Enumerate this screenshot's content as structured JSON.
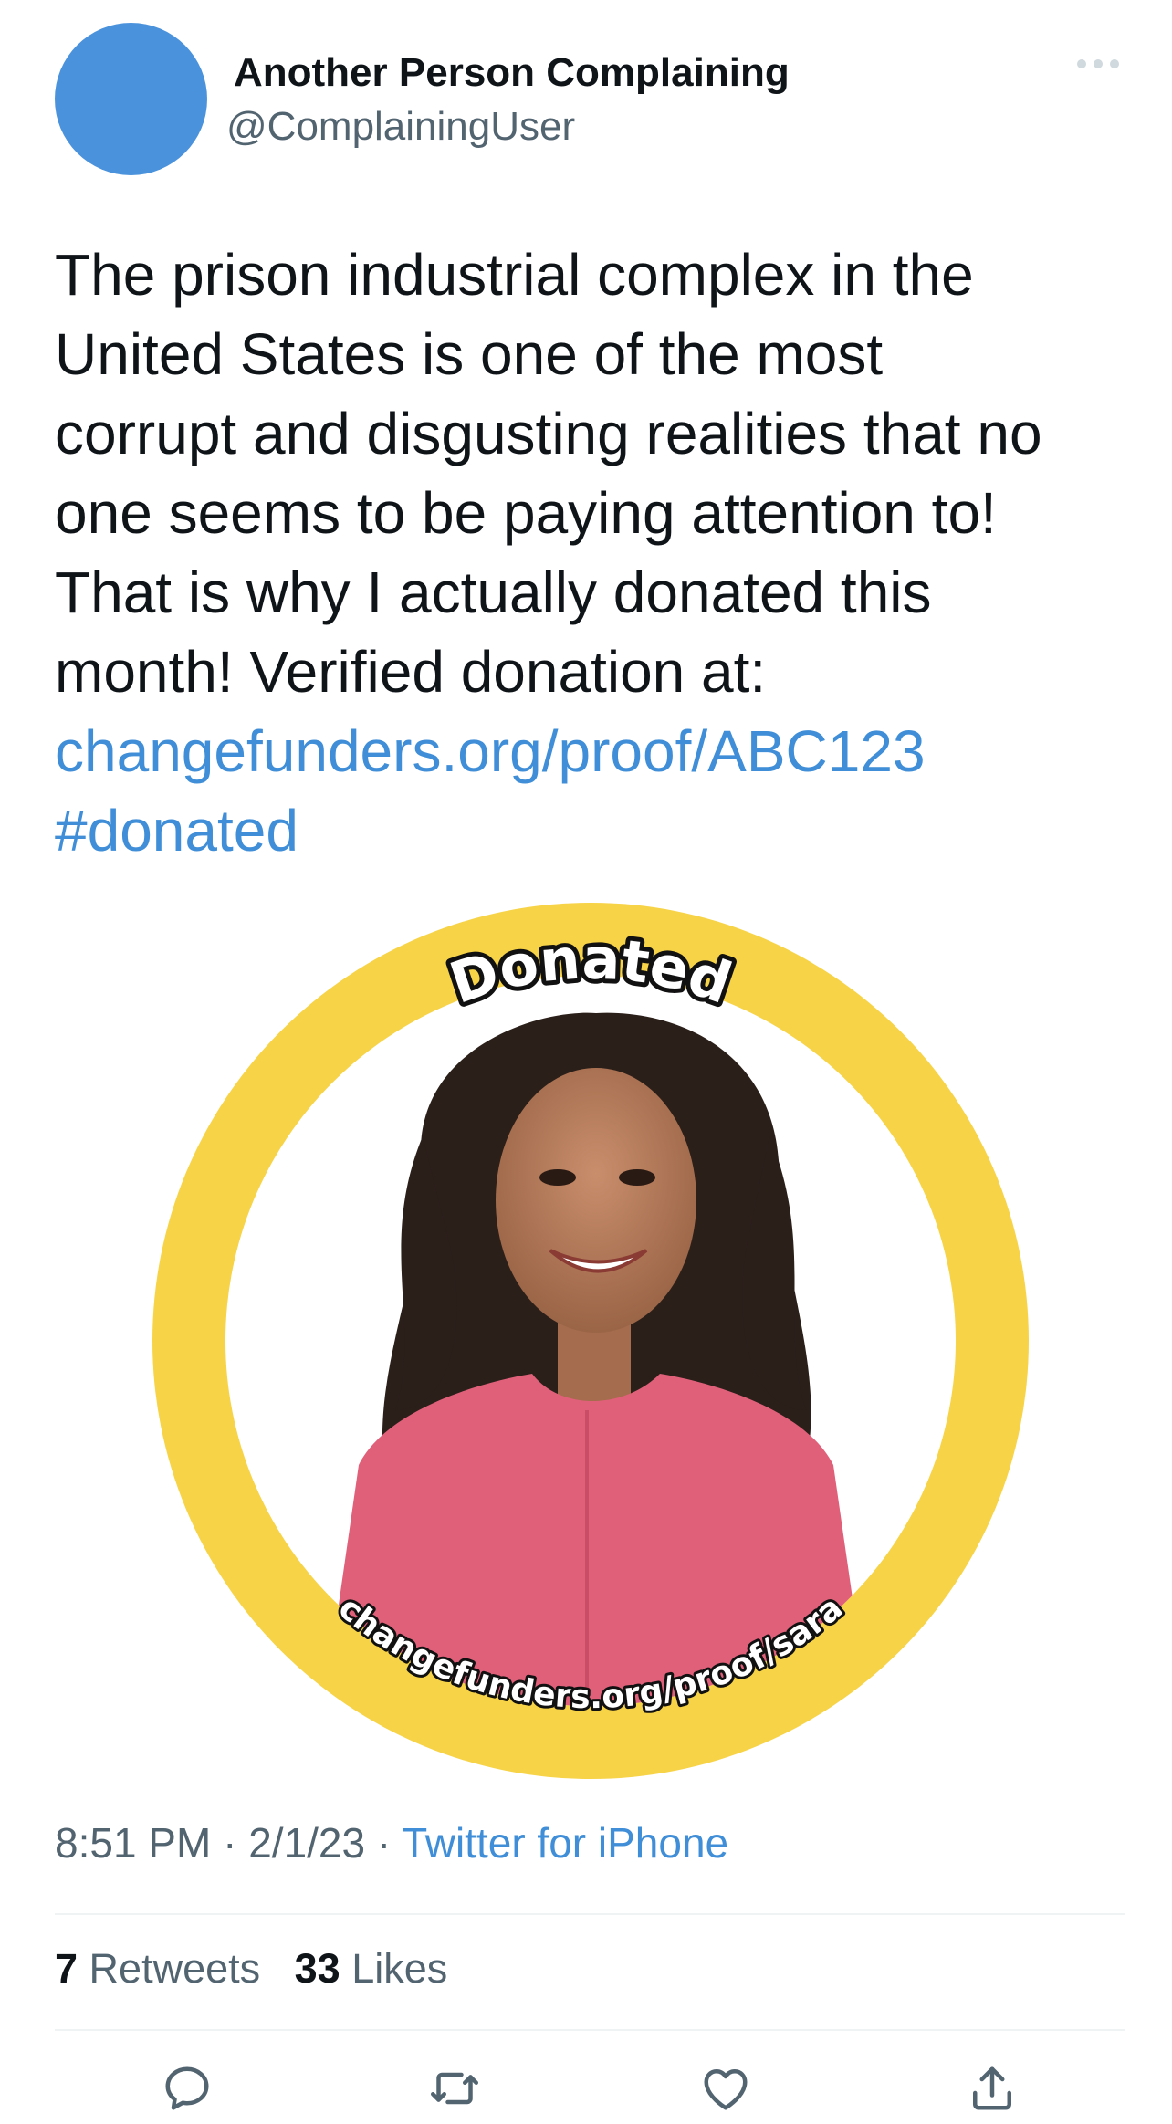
{
  "tweet": {
    "author": {
      "display_name": "Another Person Complaining",
      "handle": "@ComplainingUser",
      "avatar_color": "#4a92dc"
    },
    "more_icon": "ellipsis-icon",
    "text_lines": [
      "The prison industrial complex in the",
      "United States is one of the most",
      "corrupt and disgusting realities that no",
      "one seems to be paying attention to!",
      "That is why I actually donated this",
      "month! Verified donation at:"
    ],
    "link": "changefunders.org/proof/ABC123",
    "hashtag": "#donated",
    "image": {
      "badge_top": "Donated",
      "badge_bottom": "changefunders.org/proof/sara",
      "ring_color": "#f7d347"
    },
    "time": "8:51 PM",
    "date": "2/1/23",
    "source": "Twitter for iPhone",
    "retweets": {
      "count": "7",
      "label": "Retweets"
    },
    "likes": {
      "count": "33",
      "label": "Likes"
    },
    "actions": [
      {
        "name": "reply",
        "icon": "reply-icon"
      },
      {
        "name": "retweet",
        "icon": "retweet-icon"
      },
      {
        "name": "like",
        "icon": "heart-icon"
      },
      {
        "name": "share",
        "icon": "share-icon"
      }
    ]
  }
}
